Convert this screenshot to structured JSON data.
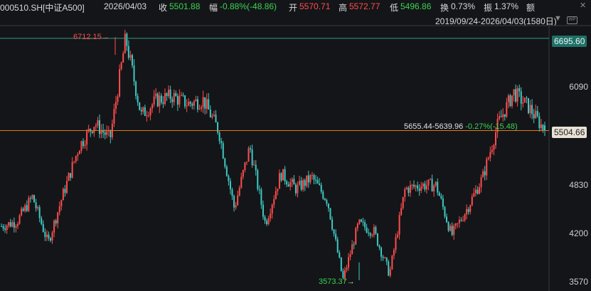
{
  "header": {
    "code": "000510.SH[中证A500]",
    "date": "2026/04/03",
    "close_label": "收",
    "close_value": "5501.88",
    "change_label": "幅",
    "change_value": "-0.88%(-48.86)",
    "open_label": "开",
    "open_value": "5570.71",
    "high_label": "高",
    "high_value": "5572.77",
    "low_label": "低",
    "low_value": "5496.86",
    "turnover_label": "换",
    "turnover_value": "0.73%",
    "amplitude_label": "振",
    "amplitude_value": "1.37%",
    "amount_label": "额"
  },
  "subheader": {
    "range_text": "2019/09/24-2026/04/03(1580日)",
    "dropdown_icon": "triangle-down-icon",
    "wp_badge": "WP",
    "close_icon": "close-icon"
  },
  "axis": {
    "ticks": [
      "6090",
      "4830",
      "4200",
      "3570"
    ],
    "current_price": "5504.66",
    "line_price": "6695.60"
  },
  "annotations": {
    "high": "6712.15",
    "low": "3573.37",
    "measure_text": "5655.44-5639.96",
    "measure_change": "-0.27%(-15.48)"
  },
  "colors": {
    "up": "#ff4d4d",
    "down": "#3ec9c4",
    "bg": "#141518",
    "hline_top": "#2f9c8d",
    "hline_price": "#e07a1f"
  },
  "chart_data": {
    "type": "candlestick",
    "title": "000510.SH[中证A500]",
    "date_range": [
      "2019/09/24",
      "2026/04/03"
    ],
    "count": 1580,
    "ylim": [
      3470,
      6860
    ],
    "yticks": [
      6090,
      4830,
      4200,
      3570
    ],
    "max_point": 6712.15,
    "min_point": 3573.37,
    "horizontal_lines": [
      6695.6,
      5504.66
    ],
    "last": {
      "open": 5570.71,
      "high": 5572.77,
      "low": 5496.86,
      "close": 5501.88
    },
    "approx_close_path": [
      4270,
      4330,
      4650,
      4050,
      4700,
      5300,
      5600,
      5400,
      6700,
      5700,
      5900,
      5950,
      5850,
      5900,
      5500,
      4500,
      5300,
      4300,
      4950,
      4750,
      4900,
      4600,
      3580,
      4300,
      4200,
      3650,
      4750,
      4800,
      4800,
      4150,
      4500,
      4900,
      5600,
      6000,
      5800,
      5501.88
    ]
  }
}
